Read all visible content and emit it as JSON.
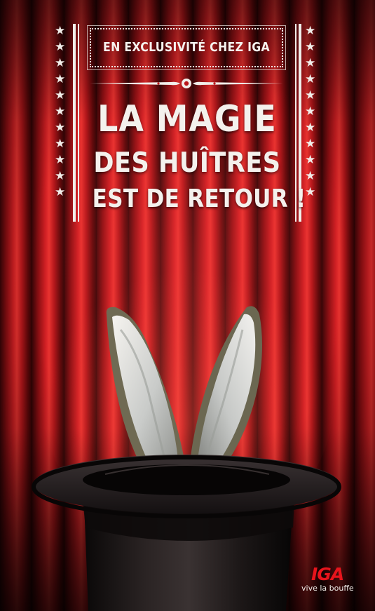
{
  "badge": {
    "text": "EN EXCLUSIVITÉ CHEZ IGA"
  },
  "headline": {
    "line1": "LA MAGIE",
    "line2": "DES HUÎTRES",
    "line3": "EST DE RETOUR !"
  },
  "brand": {
    "logo": "IGA",
    "tagline": "vive la bouffe",
    "logo_color": "#e8141c"
  },
  "palette": {
    "curtain": "#c41a1e",
    "text": "#f4f1ed",
    "hat": "#161112"
  },
  "decoration": {
    "star_glyph": "★",
    "stars_per_column": 11
  }
}
